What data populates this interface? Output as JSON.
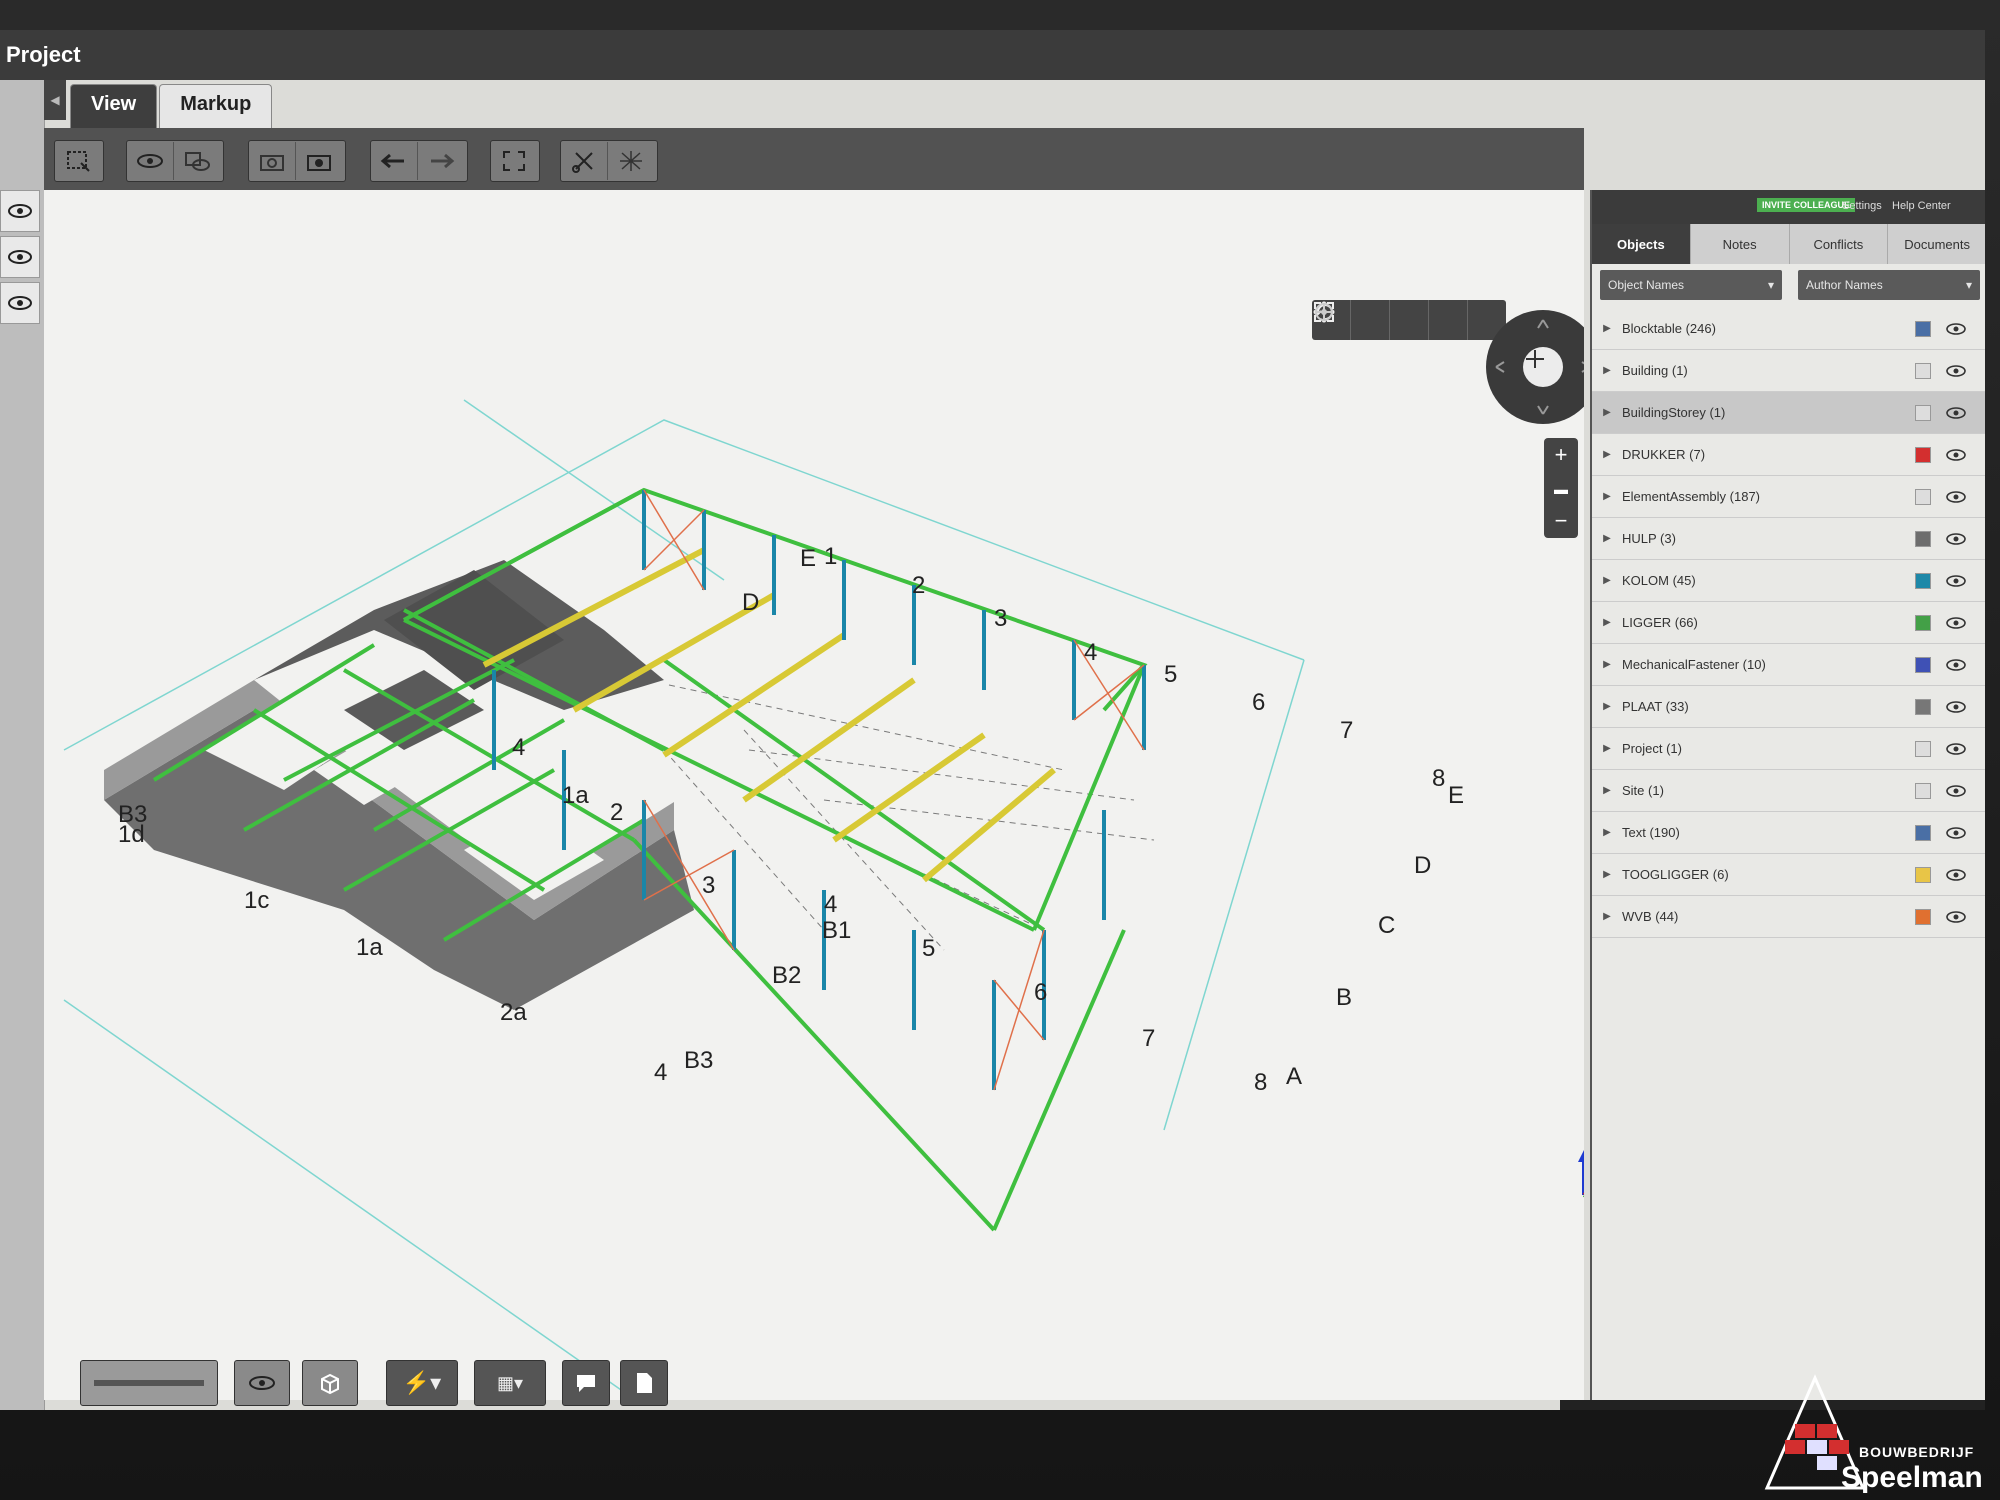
{
  "window": {
    "title": "Project"
  },
  "tabs": [
    {
      "label": "View"
    },
    {
      "label": "Markup"
    }
  ],
  "right_panel": {
    "invite_label": "INVITE COLLEAGUE",
    "top_links": [
      "Settings",
      "Help Center"
    ],
    "tabs": [
      "Objects",
      "Notes",
      "Conflicts",
      "Documents"
    ],
    "filter_object": "Object Names",
    "filter_author": "Author Names",
    "items": [
      {
        "label": "Blocktable (246)",
        "color": "#4a6fa5"
      },
      {
        "label": "Building (1)",
        "color": "#dddddd"
      },
      {
        "label": "BuildingStorey (1)",
        "color": "#dddddd"
      },
      {
        "label": "DRUKKER (7)",
        "color": "#d32f2f"
      },
      {
        "label": "ElementAssembly (187)",
        "color": "#dddddd"
      },
      {
        "label": "HULP (3)",
        "color": "#6d6d6d"
      },
      {
        "label": "KOLOM (45)",
        "color": "#1e88a8"
      },
      {
        "label": "LIGGER (66)",
        "color": "#43a047"
      },
      {
        "label": "MechanicalFastener (10)",
        "color": "#3f51b5"
      },
      {
        "label": "PLAAT (33)",
        "color": "#777777"
      },
      {
        "label": "Project (1)",
        "color": "#dddddd"
      },
      {
        "label": "Site (1)",
        "color": "#dddddd"
      },
      {
        "label": "Text (190)",
        "color": "#4a6fa5"
      },
      {
        "label": "TOOGLIGGER (6)",
        "color": "#e8c547"
      },
      {
        "label": "WVB (44)",
        "color": "#e07030"
      }
    ]
  },
  "model_labels": {
    "b3_left": "B3",
    "1d": "1d",
    "1c": "1c",
    "1a_front": "1a",
    "2a": "2a",
    "4_bottom": "4",
    "b3_bottom": "B3",
    "b2": "B2",
    "4_mid": "4",
    "b1": "B1",
    "5_front": "5",
    "6_front": "6",
    "7_front": "7",
    "8_front": "8",
    "a_front": "A",
    "b_right": "B",
    "c_right": "C",
    "d_right": "D",
    "e_right": "E",
    "8_right": "8",
    "1a_inner": "1a",
    "2_inner": "2",
    "3_inner": "3",
    "4_inner": "4",
    "e1_top": "E",
    "1_top": "1",
    "d_top": "D",
    "2_top": "2",
    "3_top": "3",
    "4_top": "4",
    "5_top": "5",
    "6_top": "6",
    "7_top": "7"
  },
  "watermark": {
    "line1": "BOUWBEDRIJF",
    "line2": "Speelman"
  },
  "colors": {
    "beam": "#3fbf3f",
    "column": "#1a86a8",
    "purlin": "#d8c935",
    "wall": "#6f6f6f",
    "brace": "#e0704a"
  }
}
